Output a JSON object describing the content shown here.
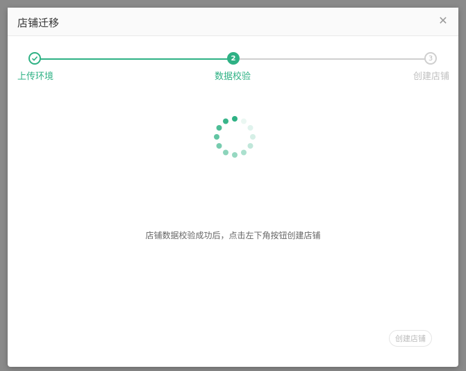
{
  "modal": {
    "title": "店铺迁移"
  },
  "steps": [
    {
      "index": "1",
      "label": "上传环境",
      "state": "done"
    },
    {
      "index": "2",
      "label": "数据校验",
      "state": "active"
    },
    {
      "index": "3",
      "label": "创建店铺",
      "state": "pending"
    }
  ],
  "message": "店铺数据校验成功后，点击左下角按钮创建店铺",
  "button": {
    "create_label": "创建店铺"
  },
  "colors": {
    "accent": "#2eb184",
    "pending": "#cfcfcf"
  },
  "icons": {
    "close": "close-icon",
    "check": "check-icon",
    "loading": "loading-spinner-icon"
  }
}
